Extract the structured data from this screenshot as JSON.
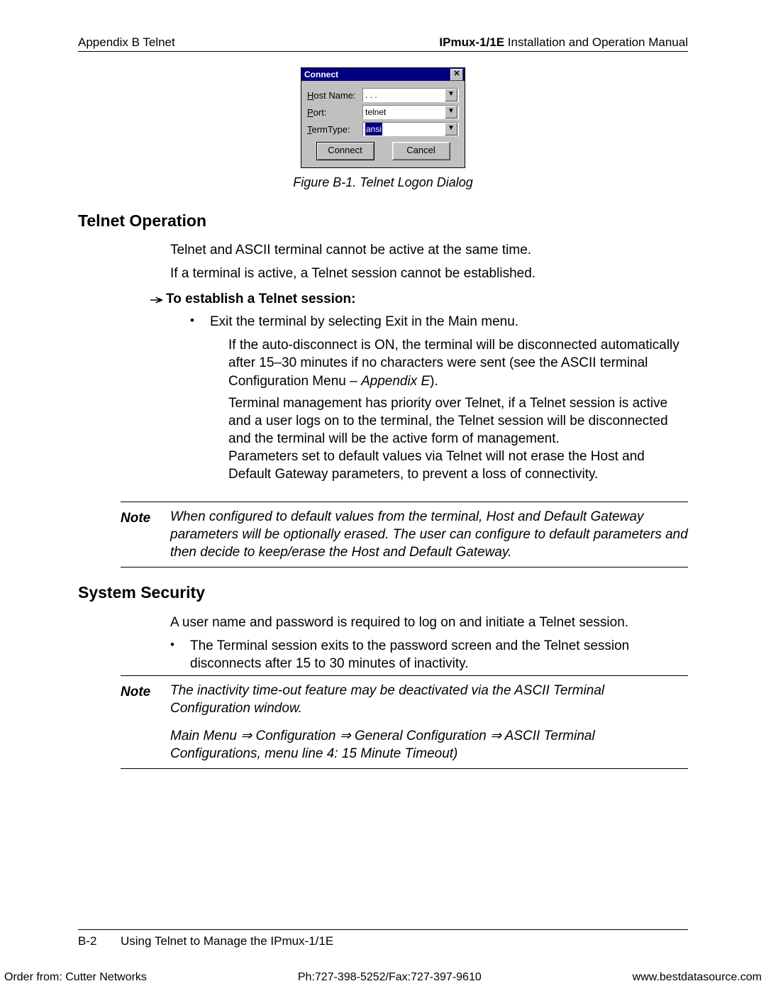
{
  "header": {
    "left": "Appendix B  Telnet",
    "right_bold": "IPmux-1/1E",
    "right_rest": " Installation and Operation Manual"
  },
  "dialog": {
    "title": "Connect",
    "close": "✕",
    "rows": {
      "host_label_u": "H",
      "host_label_rest": "ost Name:",
      "host_value": ". . .",
      "port_label_u": "P",
      "port_label_rest": "ort:",
      "port_value": "telnet",
      "term_label_u": "T",
      "term_label_rest": "ermType:",
      "term_value": "ansi"
    },
    "buttons": {
      "connect": "Connect",
      "cancel": "Cancel"
    },
    "dd": "▼"
  },
  "caption": "Figure B-1.  Telnet Logon Dialog",
  "sec1": {
    "title": "Telnet Operation",
    "p1": "Telnet and ASCII terminal cannot be active at the same time.",
    "p2": "If a terminal is active, a Telnet session cannot be established.",
    "howto": "To establish a Telnet session:",
    "b1": "Exit the terminal by selecting Exit in the Main menu.",
    "sub1a": "If the auto-disconnect is ON, the terminal will be disconnected automatically after 15–30 minutes if no characters were sent (see the ASCII terminal Configuration Menu – ",
    "sub1b_em": "Appendix E",
    "sub1c": ").",
    "sub2": "Terminal management has priority over Telnet, if a Telnet session is active and a user logs on to the terminal, the Telnet session will be disconnected and the terminal will be the active form of management.",
    "sub3": "Parameters set to default values via Telnet will not erase the Host and Default Gateway parameters, to prevent a loss of connectivity.",
    "note_label": "Note",
    "note_body": "When configured to default values from the terminal, Host and Default Gateway parameters will be optionally erased. The user can configure to default parameters and then decide to keep/erase the Host and Default Gateway."
  },
  "sec2": {
    "title": "System Security",
    "p1": "A user name and password is required to log on and initiate a Telnet session.",
    "b1": "The Terminal session exits to the password screen and the Telnet session disconnects after 15 to 30 minutes of inactivity.",
    "note_label": "Note",
    "note_b1": "The inactivity time-out feature may be deactivated via the ASCII Terminal Configuration window.",
    "note_b2": "Main Menu ⇒ Configuration ⇒ General Configuration ⇒ ASCII Terminal Configurations, menu line 4: 15 Minute Timeout)"
  },
  "footer": {
    "page": "B-2",
    "title": "Using Telnet to Manage the IPmux-1/1E",
    "order": "Order from: Cutter Networks",
    "phone": "Ph:727-398-5252/Fax:727-397-9610",
    "url": "www.bestdatasource.com"
  }
}
